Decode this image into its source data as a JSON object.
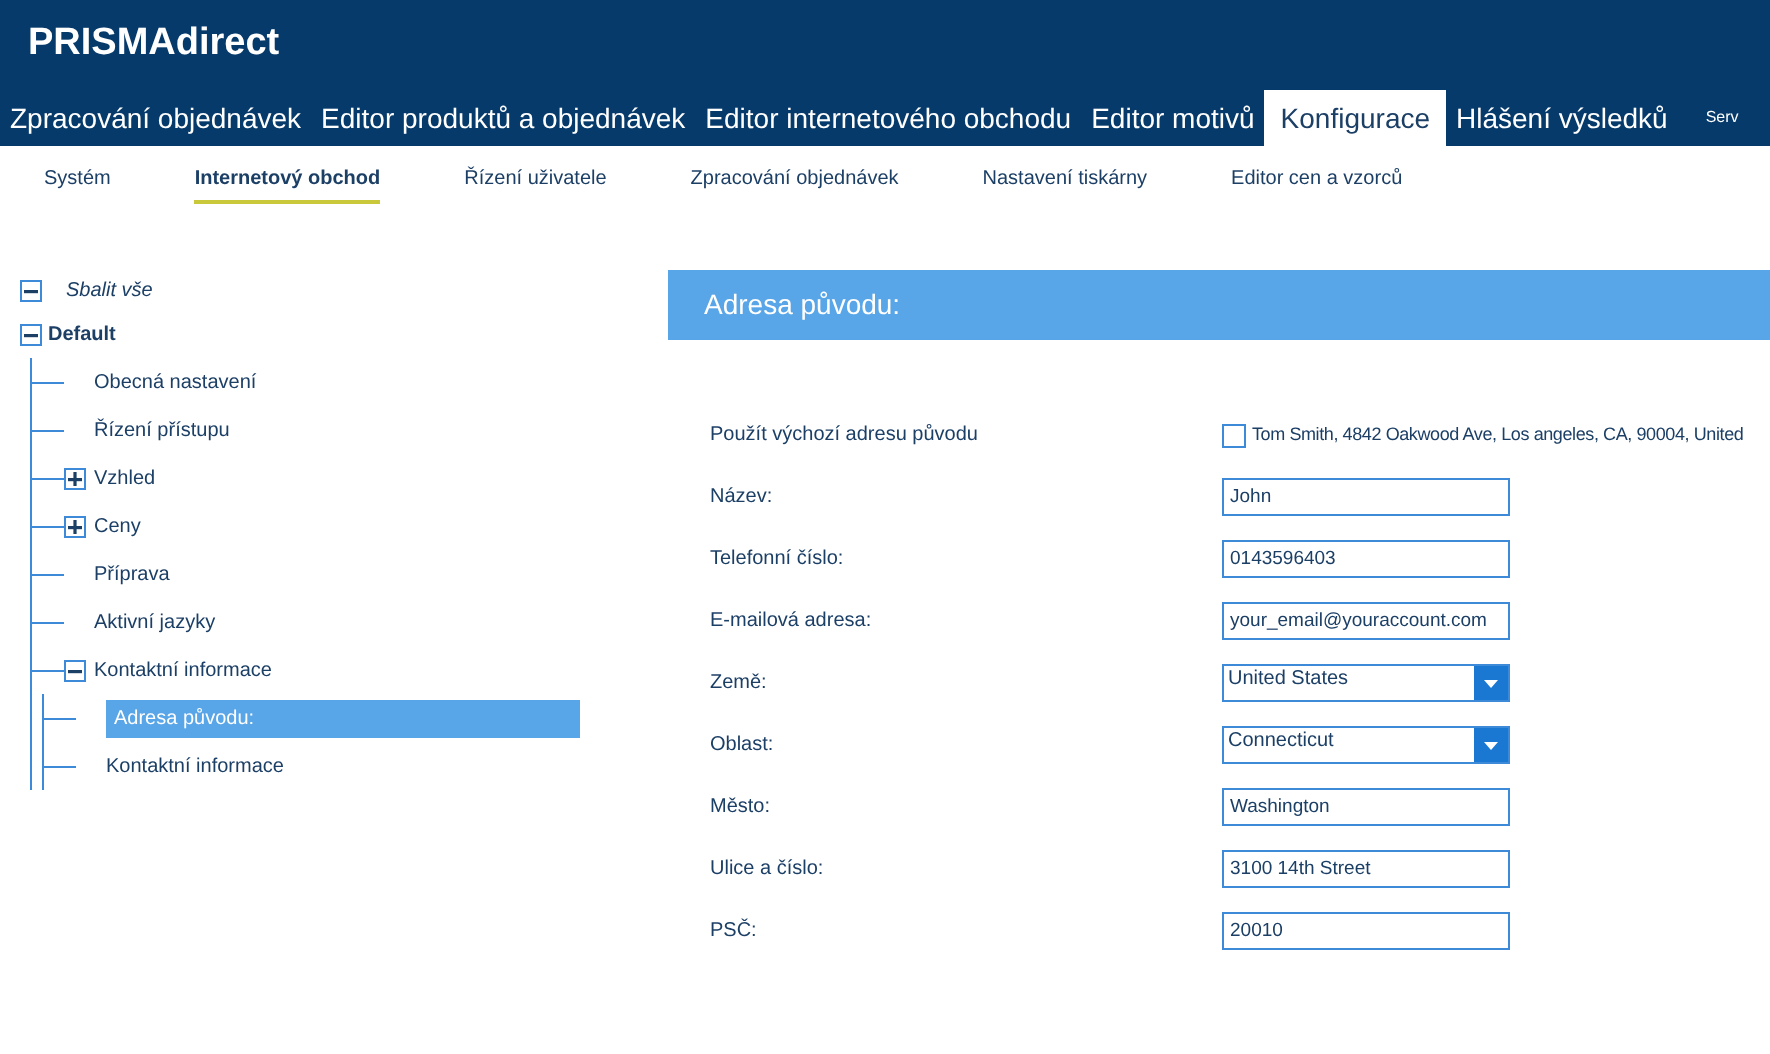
{
  "app": {
    "logo": "PRISMAdirect"
  },
  "main_tabs": [
    {
      "label": "Zpracování objednávek",
      "selected": false
    },
    {
      "label": "Editor produktů a objednávek",
      "selected": false
    },
    {
      "label": "Editor internetového obchodu",
      "selected": false
    },
    {
      "label": "Editor motivů",
      "selected": false
    },
    {
      "label": "Konfigurace",
      "selected": true
    },
    {
      "label": "Hlášení výsledků",
      "selected": false
    },
    {
      "label": "Serv",
      "selected": false
    }
  ],
  "sub_tabs": [
    {
      "label": "Systém",
      "selected": false
    },
    {
      "label": "Internetový obchod",
      "selected": true
    },
    {
      "label": "Řízení uživatele",
      "selected": false
    },
    {
      "label": "Zpracování objednávek",
      "selected": false
    },
    {
      "label": "Nastavení tiskárny",
      "selected": false
    },
    {
      "label": "Editor cen a vzorců",
      "selected": false
    }
  ],
  "tree": {
    "collapse_all": "Sbalit vše",
    "root": {
      "label": "Default",
      "expanded": true,
      "children": [
        {
          "label": "Obecná nastavení",
          "selected": false
        },
        {
          "label": "Řízení přístupu",
          "selected": false
        },
        {
          "label": "Vzhled",
          "selected": false,
          "expanded": false
        },
        {
          "label": "Ceny",
          "selected": false,
          "expanded": false
        },
        {
          "label": "Příprava",
          "selected": false
        },
        {
          "label": "Aktivní jazyky",
          "selected": false
        },
        {
          "label": "Kontaktní informace",
          "selected": false,
          "expanded": true,
          "children": [
            {
              "label": "Adresa původu:",
              "selected": true
            },
            {
              "label": "Kontaktní informace",
              "selected": false
            }
          ]
        }
      ]
    }
  },
  "panel": {
    "title": "Adresa původu:",
    "fields": [
      {
        "kind": "checkbox",
        "label": "Použít výchozí adresu původu",
        "checked": false,
        "value": "Tom Smith, 4842 Oakwood Ave, Los angeles, CA, 90004, United"
      },
      {
        "kind": "text",
        "label": "Název:",
        "value": "John"
      },
      {
        "kind": "text",
        "label": "Telefonní číslo:",
        "value": "0143596403"
      },
      {
        "kind": "text",
        "label": "E-mailová adresa:",
        "value": "your_email@youraccount.com"
      },
      {
        "kind": "select",
        "label": "Země:",
        "value": "United States"
      },
      {
        "kind": "select",
        "label": "Oblast:",
        "value": "Connecticut"
      },
      {
        "kind": "text",
        "label": "Město:",
        "value": "Washington"
      },
      {
        "kind": "text",
        "label": "Ulice a číslo:",
        "value": "3100 14th Street"
      },
      {
        "kind": "text",
        "label": "PSČ:",
        "value": "20010"
      }
    ]
  }
}
